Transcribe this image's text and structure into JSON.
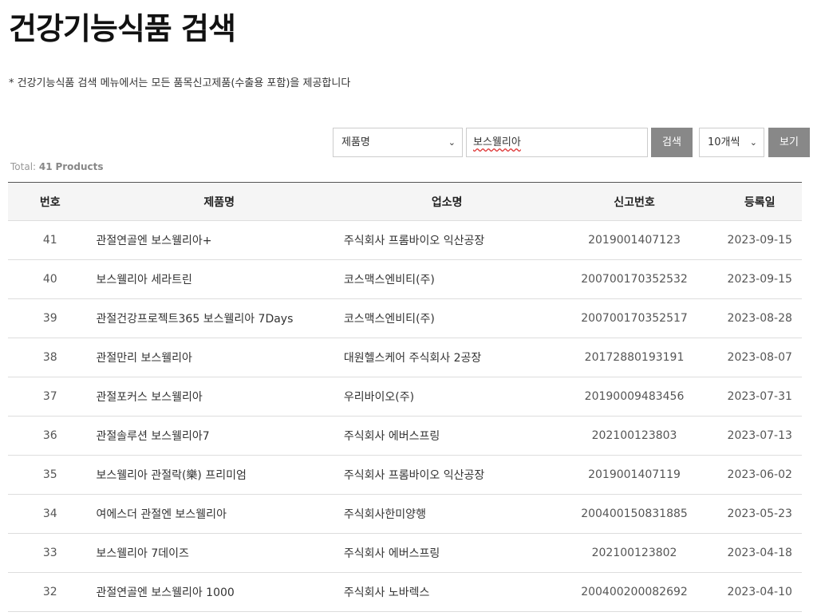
{
  "page": {
    "title": "건강기능식품 검색",
    "notice": "* 건강기능식품 검색 메뉴에서는 모든 품목신고제품(수출용 포함)을 제공합니다"
  },
  "search": {
    "field_select_value": "제품명",
    "query_value": "보스웰리아",
    "search_button": "검색",
    "count_select_value": "10개씩",
    "view_button": "보기"
  },
  "summary": {
    "total_prefix": "Total:",
    "total_count": "41",
    "total_suffix": "Products"
  },
  "table": {
    "headers": [
      "번호",
      "제품명",
      "업소명",
      "신고번호",
      "등록일"
    ],
    "rows": [
      {
        "num": "41",
        "name": "관절연골엔 보스웰리아+",
        "company": "주식회사 프롬바이오 익산공장",
        "reg": "2019001407123",
        "date": "2023-09-15"
      },
      {
        "num": "40",
        "name": "보스웰리아 세라트린",
        "company": "코스맥스엔비티(주)",
        "reg": "200700170352532",
        "date": "2023-09-15"
      },
      {
        "num": "39",
        "name": "관절건강프로젝트365 보스웰리아 7Days",
        "company": "코스맥스엔비티(주)",
        "reg": "200700170352517",
        "date": "2023-08-28"
      },
      {
        "num": "38",
        "name": "관절만리 보스웰리아",
        "company": "대원헬스케어 주식회사 2공장",
        "reg": "20172880193191",
        "date": "2023-08-07"
      },
      {
        "num": "37",
        "name": "관절포커스 보스웰리아",
        "company": "우리바이오(주)",
        "reg": "20190009483456",
        "date": "2023-07-31"
      },
      {
        "num": "36",
        "name": "관절솔루션 보스웰리아7",
        "company": "주식회사 에버스프링",
        "reg": "202100123803",
        "date": "2023-07-13"
      },
      {
        "num": "35",
        "name": "보스웰리아 관절락(樂) 프리미엄",
        "company": "주식회사 프롬바이오 익산공장",
        "reg": "2019001407119",
        "date": "2023-06-02"
      },
      {
        "num": "34",
        "name": "여에스더 관절엔 보스웰리아",
        "company": "주식회사한미양행",
        "reg": "200400150831885",
        "date": "2023-05-23"
      },
      {
        "num": "33",
        "name": "보스웰리아 7데이즈",
        "company": "주식회사 에버스프링",
        "reg": "202100123802",
        "date": "2023-04-18"
      },
      {
        "num": "32",
        "name": "관절연골엔 보스웰리아 1000",
        "company": "주식회사 노바렉스",
        "reg": "200400200082692",
        "date": "2023-04-10"
      }
    ]
  }
}
